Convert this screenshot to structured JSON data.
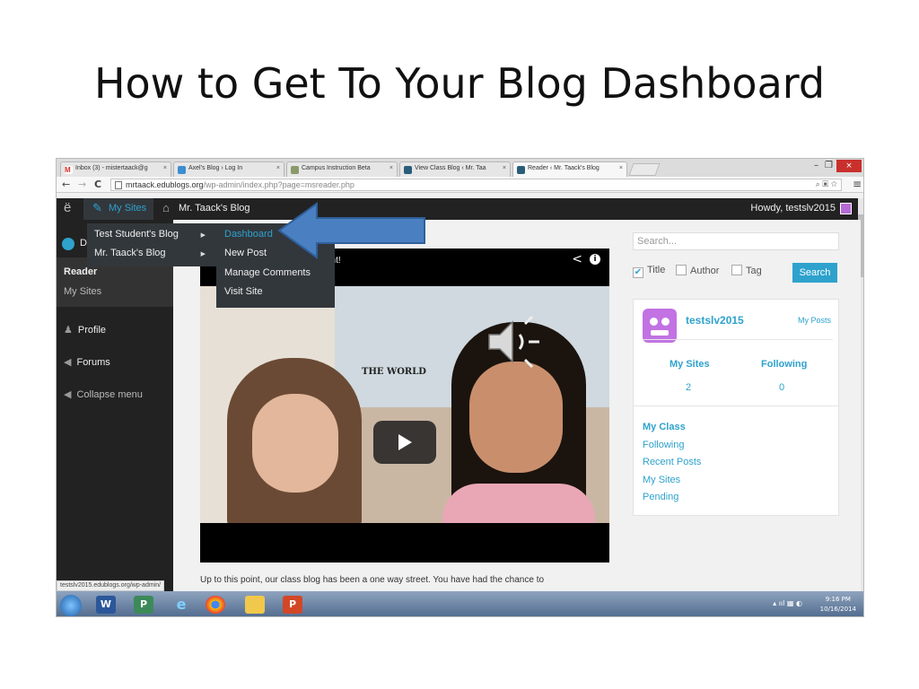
{
  "slide": {
    "title": "How to Get To Your Blog Dashboard"
  },
  "browser": {
    "tabs": [
      {
        "label": "Inbox (3) - mistertaack@g",
        "icon": "gmail-icon"
      },
      {
        "label": "Axel's Blog › Log In",
        "icon": "edublogs-icon"
      },
      {
        "label": "Campus Instruction Beta",
        "icon": "campus-icon"
      },
      {
        "label": "View Class Blog ‹ Mr. Taa",
        "icon": "edublogs-icon"
      },
      {
        "label": "Reader ‹ Mr. Taack's Blog",
        "icon": "edublogs-icon"
      }
    ],
    "tab_close": "×",
    "url_host": "mrtaack.edublogs.org",
    "url_path": "/wp-admin/index.php?page=msreader.php",
    "win_minimize": "–",
    "win_restore": "❐",
    "win_close": "×"
  },
  "adminbar": {
    "my_sites": "My Sites",
    "blog_name": "Mr. Taack's Blog",
    "howdy": "Howdy, testslv2015"
  },
  "flyout": {
    "blogs": [
      "Test Student's Blog",
      "Mr. Taack's Blog"
    ],
    "submenu": [
      "Dashboard",
      "New Post",
      "Manage Comments",
      "Visit Site"
    ]
  },
  "sidemenu": {
    "dash_letter": "D",
    "reader": "Reader",
    "my_sites": "My Sites",
    "profile": "Profile",
    "forums": "Forums",
    "collapse": "Collapse menu"
  },
  "video": {
    "title_fragment": "ent!",
    "map_text": "THE WORLD"
  },
  "main": {
    "body_text": "Up to this point, our class blog has been a one way street.  You have had the chance to"
  },
  "sidebar": {
    "search_placeholder": "Search...",
    "filter_title": "Title",
    "filter_author": "Author",
    "filter_tag": "Tag",
    "search_button": "Search",
    "username": "testslv2015",
    "my_posts": "My Posts",
    "my_sites_label": "My Sites",
    "my_sites_count": "2",
    "following_label": "Following",
    "following_count": "0",
    "links": [
      "My Class",
      "Following",
      "Recent Posts",
      "My Sites",
      "Pending"
    ]
  },
  "status_url": "testslv2015.edublogs.org/wp-admin/",
  "taskbar": {
    "time": "9:16 PM",
    "date": "10/16/2014"
  },
  "colors": {
    "accent": "#2ea2cc",
    "adminbar": "#222222",
    "arrow": "#4a7fc1"
  }
}
